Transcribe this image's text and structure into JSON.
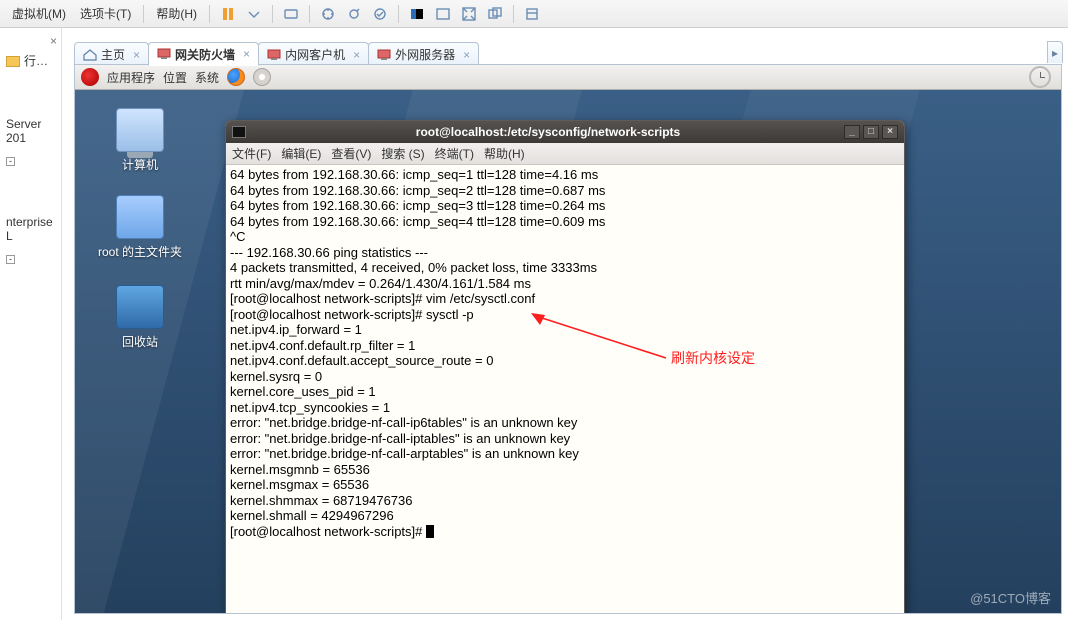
{
  "host": {
    "menus": {
      "vm": "虚拟机(M)",
      "tabs": "选项卡(T)",
      "help": "帮助(H)"
    }
  },
  "left": {
    "close": "×",
    "row1": "行…",
    "node1": "Server 201",
    "node2": "nterprise L"
  },
  "tabs": {
    "home": "主页",
    "t1": "网关防火墙",
    "t2": "内网客户机",
    "t3": "外网服务器",
    "close": "×"
  },
  "gnome": {
    "apps": "应用程序",
    "places": "位置",
    "system": "系统"
  },
  "desk": {
    "computer": "计算机",
    "home": "root 的主文件夹",
    "trash": "回收站"
  },
  "term": {
    "title": "root@localhost:/etc/sysconfig/network-scripts",
    "menu_file": "文件(F)",
    "menu_edit": "编辑(E)",
    "menu_view": "查看(V)",
    "menu_search": "搜索 (S)",
    "menu_term": "终端(T)",
    "menu_help": "帮助(H)",
    "min": "_",
    "max": "□",
    "close": "×",
    "lines": [
      "64 bytes from 192.168.30.66: icmp_seq=1 ttl=128 time=4.16 ms",
      "64 bytes from 192.168.30.66: icmp_seq=2 ttl=128 time=0.687 ms",
      "64 bytes from 192.168.30.66: icmp_seq=3 ttl=128 time=0.264 ms",
      "64 bytes from 192.168.30.66: icmp_seq=4 ttl=128 time=0.609 ms",
      "^C",
      "--- 192.168.30.66 ping statistics ---",
      "4 packets transmitted, 4 received, 0% packet loss, time 3333ms",
      "rtt min/avg/max/mdev = 0.264/1.430/4.161/1.584 ms",
      "[root@localhost network-scripts]# vim /etc/sysctl.conf",
      "[root@localhost network-scripts]# sysctl -p",
      "net.ipv4.ip_forward = 1",
      "net.ipv4.conf.default.rp_filter = 1",
      "net.ipv4.conf.default.accept_source_route = 0",
      "kernel.sysrq = 0",
      "kernel.core_uses_pid = 1",
      "net.ipv4.tcp_syncookies = 1",
      "error: \"net.bridge.bridge-nf-call-ip6tables\" is an unknown key",
      "error: \"net.bridge.bridge-nf-call-iptables\" is an unknown key",
      "error: \"net.bridge.bridge-nf-call-arptables\" is an unknown key",
      "kernel.msgmnb = 65536",
      "kernel.msgmax = 65536",
      "kernel.shmmax = 68719476736",
      "kernel.shmall = 4294967296"
    ],
    "prompt": "[root@localhost network-scripts]# "
  },
  "annotation": "刷新内核设定",
  "watermark": "@51CTO博客"
}
